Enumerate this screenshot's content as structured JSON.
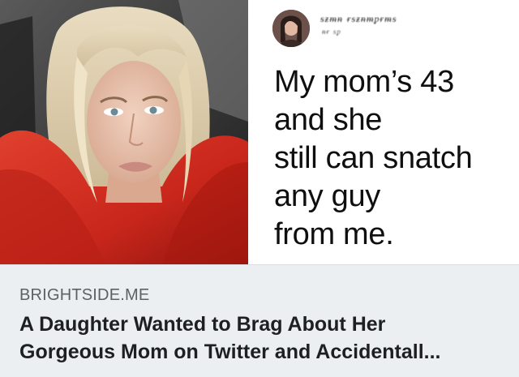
{
  "tweet": {
    "text": "My mom’s 43\nand she\nstill can snatch\nany guy\nfrom me."
  },
  "link": {
    "domain": "BRIGHTSIDE.ME",
    "headline": "A Daughter Wanted to Brag About Her\nGorgeous Mom on Twitter and Accidentall..."
  },
  "icons": {
    "photo": "portrait-photo",
    "avatar": "user-avatar-icon"
  }
}
